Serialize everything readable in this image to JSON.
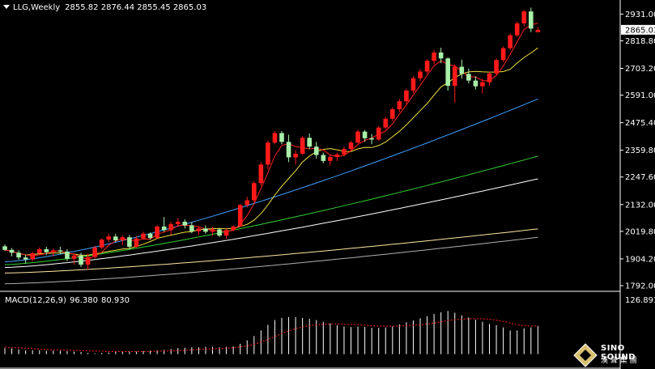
{
  "header": {
    "symbol": "LLG,Weekly",
    "open": "2855.82",
    "high": "2876.44",
    "low": "2855.45",
    "close": "2865.03"
  },
  "macd": {
    "label": "MACD(12,26,9)",
    "main": "96.380",
    "signal": "80.930"
  },
  "logo": {
    "brand": "SINO SOUND",
    "tagline": "漢 聲 集 團"
  },
  "colors": {
    "background": "#000000",
    "up_candle": "#ff1a1a",
    "down_candle": "#a8f0a8",
    "ma_fast": "#ff2020",
    "ma_yellow": "#f0e040",
    "ma_blue": "#3fa0ff",
    "ma_green": "#30d030",
    "ma_white": "#ffffff",
    "ma_cream": "#ffe8a0",
    "ma_gray": "#b0b0b0",
    "macd_hist": "#ffffff",
    "macd_signal": "#ff2020"
  },
  "chart_data": {
    "type": "candlestick",
    "timeframe": "weekly",
    "y_ticks": [
      1792.0,
      1904.2,
      2019.8,
      2132.0,
      2247.6,
      2359.8,
      2475.4,
      2591.0,
      2703.2,
      2818.8,
      2931.0
    ],
    "y_tick_labels": [
      "1792.00",
      "1904.20",
      "2019.80",
      "2132.00",
      "2247.60",
      "2359.80",
      "2475.40",
      "2591.00",
      "2703.20",
      "2818.80",
      "2931.00"
    ],
    "current_price": 2865.03,
    "current_price_label": "2865.03",
    "ylim": [
      1775,
      2990
    ],
    "ohlc": [
      [
        1957,
        1965,
        1938,
        1942
      ],
      [
        1942,
        1950,
        1915,
        1930
      ],
      [
        1930,
        1940,
        1900,
        1910
      ],
      [
        1910,
        1922,
        1885,
        1902
      ],
      [
        1902,
        1935,
        1895,
        1928
      ],
      [
        1928,
        1952,
        1920,
        1945
      ],
      [
        1945,
        1955,
        1920,
        1932
      ],
      [
        1932,
        1948,
        1915,
        1940
      ],
      [
        1940,
        1955,
        1925,
        1935
      ],
      [
        1935,
        1945,
        1895,
        1905
      ],
      [
        1905,
        1925,
        1880,
        1918
      ],
      [
        1918,
        1930,
        1870,
        1880
      ],
      [
        1880,
        1925,
        1860,
        1912
      ],
      [
        1912,
        1960,
        1905,
        1952
      ],
      [
        1952,
        1990,
        1945,
        1985
      ],
      [
        1985,
        2010,
        1975,
        1998
      ],
      [
        1998,
        2010,
        1975,
        1982
      ],
      [
        1982,
        2002,
        1962,
        1995
      ],
      [
        1995,
        2005,
        1945,
        1955
      ],
      [
        1955,
        2000,
        1950,
        1990
      ],
      [
        1990,
        2018,
        1985,
        2010
      ],
      [
        2010,
        2015,
        1985,
        1992
      ],
      [
        1992,
        2045,
        1988,
        2040
      ],
      [
        2040,
        2080,
        2018,
        2025
      ],
      [
        2025,
        2060,
        2005,
        2050
      ],
      [
        2050,
        2075,
        2040,
        2060
      ],
      [
        2060,
        2070,
        2032,
        2045
      ],
      [
        2045,
        2058,
        2012,
        2020
      ],
      [
        2020,
        2042,
        2005,
        2032
      ],
      [
        2032,
        2045,
        2010,
        2018
      ],
      [
        2018,
        2038,
        2002,
        2028
      ],
      [
        2028,
        2032,
        1995,
        2002
      ],
      [
        2002,
        2032,
        1988,
        2025
      ],
      [
        2025,
        2045,
        2020,
        2040
      ],
      [
        2040,
        2135,
        2038,
        2130
      ],
      [
        2130,
        2165,
        2120,
        2150
      ],
      [
        2150,
        2230,
        2140,
        2222
      ],
      [
        2222,
        2310,
        2210,
        2300
      ],
      [
        2300,
        2400,
        2280,
        2392
      ],
      [
        2392,
        2440,
        2385,
        2432
      ],
      [
        2432,
        2440,
        2385,
        2395
      ],
      [
        2395,
        2425,
        2310,
        2330
      ],
      [
        2330,
        2360,
        2300,
        2345
      ],
      [
        2345,
        2420,
        2340,
        2412
      ],
      [
        2412,
        2430,
        2365,
        2375
      ],
      [
        2375,
        2395,
        2325,
        2340
      ],
      [
        2340,
        2350,
        2305,
        2315
      ],
      [
        2315,
        2340,
        2295,
        2332
      ],
      [
        2332,
        2350,
        2315,
        2342
      ],
      [
        2342,
        2375,
        2335,
        2365
      ],
      [
        2365,
        2400,
        2358,
        2392
      ],
      [
        2392,
        2445,
        2388,
        2438
      ],
      [
        2438,
        2445,
        2395,
        2410
      ],
      [
        2410,
        2428,
        2385,
        2405
      ],
      [
        2405,
        2462,
        2400,
        2455
      ],
      [
        2455,
        2500,
        2448,
        2492
      ],
      [
        2492,
        2540,
        2482,
        2532
      ],
      [
        2532,
        2575,
        2520,
        2565
      ],
      [
        2565,
        2618,
        2555,
        2610
      ],
      [
        2610,
        2670,
        2600,
        2662
      ],
      [
        2662,
        2700,
        2650,
        2690
      ],
      [
        2690,
        2742,
        2680,
        2735
      ],
      [
        2735,
        2780,
        2720,
        2770
      ],
      [
        2770,
        2790,
        2725,
        2745
      ],
      [
        2745,
        2750,
        2610,
        2630
      ],
      [
        2630,
        2720,
        2560,
        2710
      ],
      [
        2710,
        2740,
        2660,
        2680
      ],
      [
        2680,
        2702,
        2640,
        2652
      ],
      [
        2652,
        2670,
        2615,
        2628
      ],
      [
        2628,
        2660,
        2598,
        2645
      ],
      [
        2645,
        2690,
        2630,
        2682
      ],
      [
        2682,
        2745,
        2675,
        2738
      ],
      [
        2738,
        2795,
        2730,
        2788
      ],
      [
        2788,
        2850,
        2780,
        2842
      ],
      [
        2842,
        2900,
        2835,
        2892
      ],
      [
        2892,
        2948,
        2880,
        2942
      ],
      [
        2942,
        2958,
        2855,
        2870
      ],
      [
        2855,
        2876,
        2855,
        2865
      ]
    ],
    "moving_averages": [
      {
        "color": "#3fa0ff",
        "from": [
          1892,
          1935
        ],
        "to": [
          2575,
          2555
        ]
      },
      {
        "color": "#30d030",
        "from": [
          1880,
          1915
        ],
        "to": [
          2335,
          2345
        ]
      },
      {
        "color": "#ffffff",
        "from": [
          1868,
          1905
        ],
        "to": [
          2240,
          2260
        ]
      },
      {
        "color": "#ffe8a0",
        "from": [
          1845,
          1895
        ],
        "to": [
          2030,
          2052
        ]
      },
      {
        "color": "#b0b0b0",
        "from": [
          1800,
          1840
        ],
        "to": [
          1995,
          2012
        ]
      }
    ],
    "macd_ylim": [
      -10,
      126.891
    ],
    "macd_hist": [
      14,
      13,
      11,
      9,
      9,
      9,
      8,
      8,
      8,
      7,
      6,
      5,
      3,
      2,
      3,
      4,
      5,
      6,
      6,
      6,
      7,
      8,
      9,
      10,
      12,
      14,
      15,
      16,
      16,
      17,
      17,
      16,
      17,
      18,
      24,
      32,
      42,
      55,
      68,
      79,
      84,
      86,
      86,
      84,
      82,
      79,
      75,
      71,
      67,
      64,
      63,
      64,
      63,
      61,
      61,
      62,
      64,
      69,
      74,
      78,
      83,
      88,
      93,
      97,
      100,
      96,
      90,
      85,
      80,
      75,
      70,
      67,
      62,
      55,
      55,
      60,
      62,
      65
    ],
    "macd_signal": [
      16,
      15,
      15,
      14,
      13,
      12,
      11,
      10,
      10,
      9,
      9,
      8,
      8,
      7,
      7,
      6,
      6,
      6,
      6,
      6,
      6,
      6,
      7,
      7,
      8,
      8,
      9,
      10,
      11,
      12,
      12,
      13,
      14,
      15,
      17,
      19,
      23,
      28,
      34,
      41,
      48,
      54,
      59,
      63,
      66,
      68,
      69,
      70,
      70,
      69,
      69,
      68,
      67,
      66,
      65,
      65,
      65,
      65,
      66,
      67,
      68,
      70,
      72,
      75,
      78,
      80,
      81,
      82,
      82,
      82,
      81,
      79,
      76,
      72,
      68,
      66,
      65,
      66
    ],
    "macd_current_label": "126.891"
  }
}
